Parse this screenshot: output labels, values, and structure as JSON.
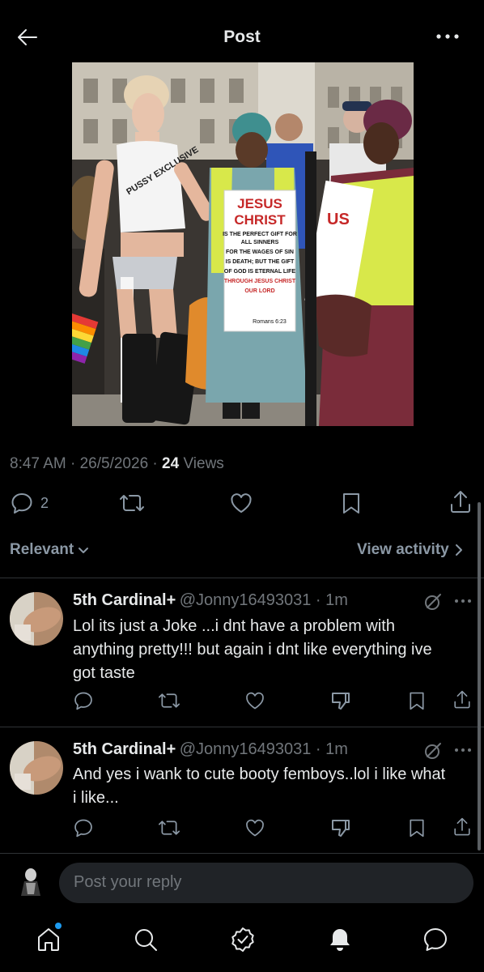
{
  "header": {
    "title": "Post"
  },
  "post": {
    "time": "8:47 AM",
    "date": "26/5/2026",
    "views_count": "24",
    "views_label": "Views",
    "reply_count": "2",
    "sign": {
      "line1": "JESUS",
      "line2": "CHRIST",
      "body": [
        "IS THE PERFECT GIFT FOR",
        "ALL SINNERS",
        "FOR THE WAGES OF SIN",
        "IS DEATH; BUT THE GIFT",
        "OF GOD IS ETERNAL LIFE",
        "THROUGH JESUS CHRIST",
        "OUR LORD"
      ],
      "verse": "Romans 6:23"
    },
    "top_text": "PUSSY EXCLUSIVE",
    "sign2": "US"
  },
  "replies_header": {
    "sort_label": "Relevant",
    "view_activity": "View activity"
  },
  "replies": [
    {
      "name": "5th Cardinal+",
      "handle": "@Jonny16493031",
      "time": "1m",
      "text": "Lol its just a Joke ...i dnt have a problem with anything pretty!!! but again i dnt like everything ive got taste"
    },
    {
      "name": "5th Cardinal+",
      "handle": "@Jonny16493031",
      "time": "1m",
      "text": "And yes i wank to cute booty femboys..lol i like what i like..."
    }
  ],
  "compose": {
    "placeholder": "Post your reply"
  },
  "colors": {
    "accent": "#1d9bf0",
    "muted": "#71767b",
    "background": "#000000"
  },
  "nav": [
    "home-icon",
    "search-icon",
    "verified-icon",
    "notifications-icon",
    "messages-icon"
  ]
}
